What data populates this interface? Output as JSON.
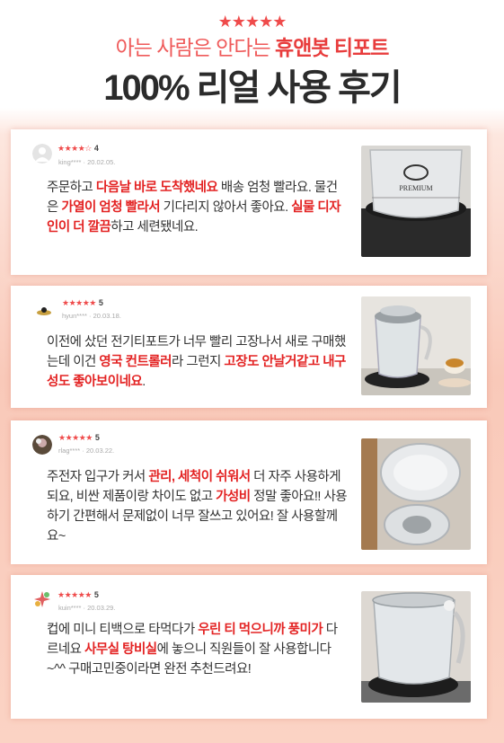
{
  "header": {
    "stars": "★★★★★",
    "subtitle_pre": "아는 사람은 안다는 ",
    "subtitle_brand": "휴앤봇 티포트",
    "title": "100% 리얼 사용 후기"
  },
  "reviews": [
    {
      "stars": "★★★★☆",
      "rating": "4",
      "user": "king**** · 20.02.05.",
      "parts": [
        {
          "t": "주문하고 ",
          "h": false
        },
        {
          "t": "다음날 바로 도착했네요",
          "h": true
        },
        {
          "t": " 배송 엄청 빨라요. 물건은 ",
          "h": false
        },
        {
          "t": "가열이 엄청 빨라서",
          "h": true
        },
        {
          "t": " 기다리지 않아서 좋아요. ",
          "h": false
        },
        {
          "t": "실물 디자인이 더 깔끔",
          "h": true
        },
        {
          "t": "하고 세련됐네요.",
          "h": false
        }
      ],
      "photo_text": "PREMIUM"
    },
    {
      "stars": "★★★★★",
      "rating": "5",
      "user": "hyun**** · 20.03.18.",
      "parts": [
        {
          "t": "이전에 샀던 전기티포트가 너무 빨리 고장나서 새로 구매했는데 이건 ",
          "h": false
        },
        {
          "t": "영국 컨트롤러",
          "h": true
        },
        {
          "t": "라 그런지 ",
          "h": false
        },
        {
          "t": "고장도 안날거같고 내구성도 좋아보이네요",
          "h": true
        },
        {
          "t": ".",
          "h": false
        }
      ]
    },
    {
      "stars": "★★★★★",
      "rating": "5",
      "user": "rlag**** · 20.03.22.",
      "parts": [
        {
          "t": "주전자 입구가 커서 ",
          "h": false
        },
        {
          "t": "관리, 세척이 쉬워서",
          "h": true
        },
        {
          "t": " 더 자주 사용하게 되요, 비싼 제품이랑 차이도 없고 ",
          "h": false
        },
        {
          "t": "가성비",
          "h": true
        },
        {
          "t": " 정말 좋아요!! 사용하기 간편해서 문제없이 너무 잘쓰고 있어요! 잘 사용할께요~",
          "h": false
        }
      ]
    },
    {
      "stars": "★★★★★",
      "rating": "5",
      "user": "kuin**** · 20.03.29.",
      "parts": [
        {
          "t": "컵에 미니 티백으로 타먹다가 ",
          "h": false
        },
        {
          "t": "우린 티 먹으니까 풍미가",
          "h": true
        },
        {
          "t": " 다르네요 ",
          "h": false
        },
        {
          "t": "사무실 탕비실",
          "h": true
        },
        {
          "t": "에 놓으니 직원들이 잘 사용합니다 ~^^ 구매고민중이라면 완전 추천드려요!",
          "h": false
        }
      ]
    }
  ],
  "colors": {
    "accent": "#e32222",
    "title": "#2b2b2b",
    "background": "#f9c9b9"
  }
}
